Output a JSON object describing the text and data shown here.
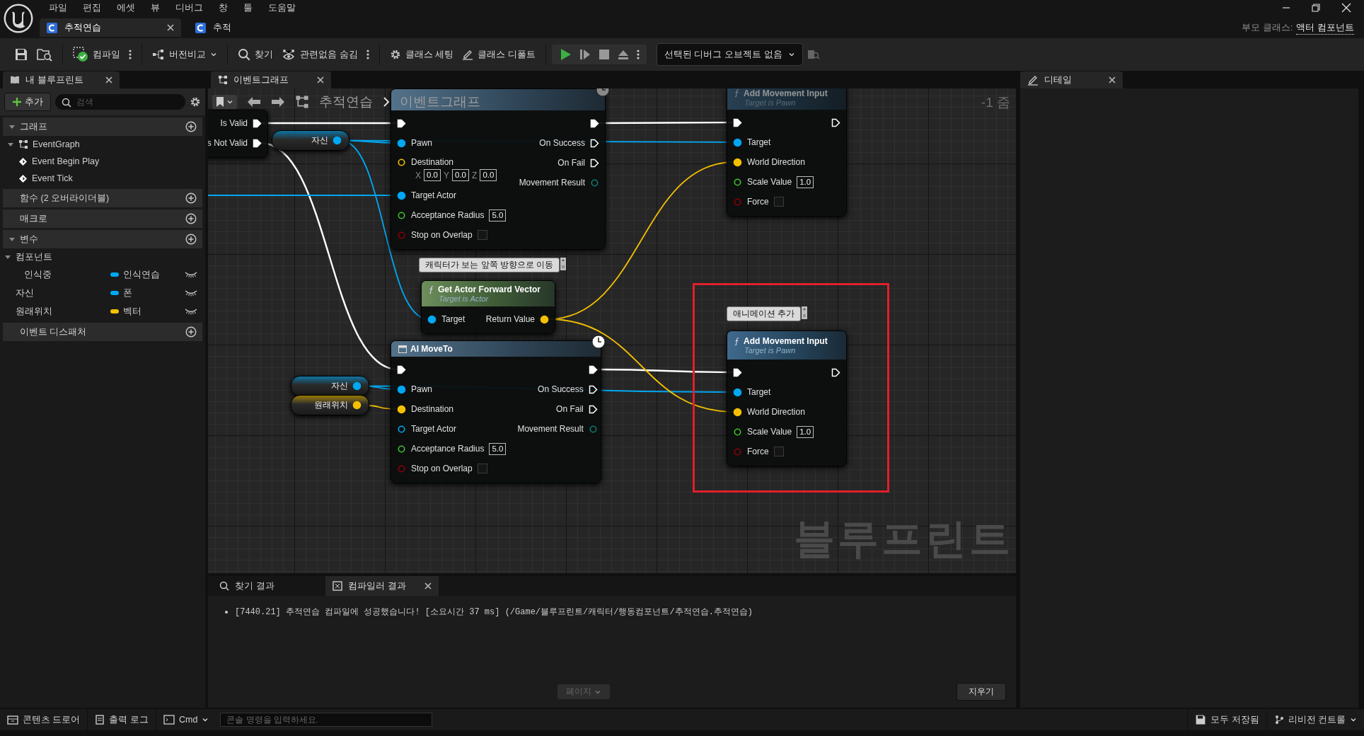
{
  "menu": [
    "파일",
    "편집",
    "에셋",
    "뷰",
    "디버그",
    "창",
    "툴",
    "도움말"
  ],
  "document_tabs": [
    {
      "label": "추적연습",
      "selected": true
    },
    {
      "label": "추적",
      "selected": false
    }
  ],
  "parent_class": {
    "label": "부모 클래스:",
    "value": "액터 컴포넌트"
  },
  "toolbar": {
    "compile": "컴파일",
    "diff": "버전비교",
    "find": "찾기",
    "hide_unrelated": "관련없음 숨김",
    "class_settings": "클래스 세팅",
    "class_defaults": "클래스 디폴트",
    "debug_object": "선택된 디버그 오브젝트 없음"
  },
  "my_blueprint": {
    "tab": "내 블루프린트",
    "add_button": "추가",
    "search_placeholder": "검색",
    "sections": [
      {
        "title": "그래프",
        "expanded": true,
        "items": [
          {
            "label": "EventGraph",
            "kind": "graph",
            "expanded": true,
            "children": [
              {
                "label": "Event Begin Play",
                "kind": "event"
              },
              {
                "label": "Event Tick",
                "kind": "event"
              }
            ]
          }
        ]
      },
      {
        "title": "함수 (2 오버라이더블)",
        "expanded": false
      },
      {
        "title": "매크로",
        "expanded": false
      },
      {
        "title": "변수",
        "expanded": true,
        "items": [
          {
            "label": "컴포넌트",
            "kind": "category",
            "expanded": true,
            "children": [
              {
                "label": "인식중",
                "kind": "variable",
                "type": "인식연습",
                "color": "#00a8f2"
              }
            ]
          },
          {
            "label": "자신",
            "kind": "variable",
            "type": "폰",
            "color": "#00a8f2"
          },
          {
            "label": "원래위치",
            "kind": "variable",
            "type": "벡터",
            "color": "#f5c000"
          }
        ]
      },
      {
        "title": "이벤트 디스패처",
        "expanded": false
      }
    ]
  },
  "graph": {
    "tab": "이벤트그래프",
    "breadcrumb": [
      "추적연습",
      "이벤트그래프"
    ],
    "zoom": "-1 줌",
    "watermark": "블루프린트",
    "nodes": [
      {
        "kind": "fragment",
        "outputs": [
          {
            "label": "Is Valid",
            "kind": "exec",
            "connected": true
          },
          {
            "label": "s Not Valid",
            "kind": "exec",
            "connected": true
          }
        ]
      },
      {
        "kind": "getter",
        "outputs": [
          {
            "label": "자신",
            "kind": "object",
            "connected": true
          }
        ]
      },
      {
        "kind": "latent",
        "inputs": [
          {
            "kind": "exec",
            "connected": true
          },
          {
            "label": "Pawn",
            "kind": "object",
            "connected": true
          },
          {
            "label": "Destination",
            "kind": "vector",
            "connected": false,
            "components": [
              {
                "axis": "X",
                "value": "0.0"
              },
              {
                "axis": "Y",
                "value": "0.0"
              },
              {
                "axis": "Z",
                "value": "0.0"
              }
            ]
          },
          {
            "label": "Target Actor",
            "kind": "object",
            "connected": true
          },
          {
            "label": "Acceptance Radius",
            "kind": "float",
            "connected": false,
            "value": "5.0"
          },
          {
            "label": "Stop on Overlap",
            "kind": "bool",
            "connected": false,
            "checked": false
          }
        ],
        "outputs": [
          {
            "kind": "exec",
            "connected": true
          },
          {
            "label": "On Success",
            "kind": "exec",
            "connected": false
          },
          {
            "label": "On Fail",
            "kind": "exec",
            "connected": false
          },
          {
            "label": "Movement Result",
            "kind": "enum",
            "connected": false
          }
        ]
      },
      {
        "kind": "function",
        "title": "Add Movement Input",
        "subtitle": "Target is Pawn",
        "inputs": [
          {
            "kind": "exec",
            "connected": true
          },
          {
            "label": "Target",
            "kind": "object",
            "connected": true
          },
          {
            "label": "World Direction",
            "kind": "vector",
            "connected": true
          },
          {
            "label": "Scale Value",
            "kind": "float",
            "connected": false,
            "value": "1.0"
          },
          {
            "label": "Force",
            "kind": "bool",
            "connected": false,
            "checked": false
          }
        ],
        "outputs": [
          {
            "kind": "exec",
            "connected": false
          }
        ]
      },
      {
        "kind": "pure",
        "title": "Get Actor Forward Vector",
        "subtitle": "Target is Actor",
        "inputs": [
          {
            "label": "Target",
            "kind": "object",
            "connected": true
          }
        ],
        "outputs": [
          {
            "label": "Return Value",
            "kind": "vector",
            "connected": true
          }
        ]
      },
      {
        "kind": "latent",
        "title": "AI MoveTo",
        "inputs": [
          {
            "kind": "exec",
            "connected": true
          },
          {
            "label": "Pawn",
            "kind": "object",
            "connected": true
          },
          {
            "label": "Destination",
            "kind": "vector",
            "connected": true
          },
          {
            "label": "Target Actor",
            "kind": "object",
            "connected": false
          },
          {
            "label": "Acceptance Radius",
            "kind": "float",
            "connected": false,
            "value": "5.0"
          },
          {
            "label": "Stop on Overlap",
            "kind": "bool",
            "connected": false,
            "checked": false
          }
        ],
        "outputs": [
          {
            "kind": "exec",
            "connected": true
          },
          {
            "label": "On Success",
            "kind": "exec",
            "connected": false
          },
          {
            "label": "On Fail",
            "kind": "exec",
            "connected": false
          },
          {
            "label": "Movement Result",
            "kind": "enum",
            "connected": false
          }
        ]
      },
      {
        "kind": "function",
        "title": "Add Movement Input",
        "subtitle": "Target is Pawn",
        "inputs": [
          {
            "kind": "exec",
            "connected": true
          },
          {
            "label": "Target",
            "kind": "object",
            "connected": true
          },
          {
            "label": "World Direction",
            "kind": "vector",
            "connected": true
          },
          {
            "label": "Scale Value",
            "kind": "float",
            "connected": false,
            "value": "1.0"
          },
          {
            "label": "Force",
            "kind": "bool",
            "connected": false,
            "checked": false
          }
        ],
        "outputs": [
          {
            "kind": "exec",
            "connected": false
          }
        ]
      },
      {
        "kind": "getter",
        "outputs": [
          {
            "label": "자신",
            "kind": "object",
            "connected": true
          }
        ]
      },
      {
        "kind": "getter",
        "outputs": [
          {
            "label": "원래위치",
            "kind": "vector",
            "connected": true
          }
        ]
      }
    ],
    "comments": [
      {
        "text": "캐릭터가 보는 앞쪽 방향으로 이동"
      },
      {
        "text": "애니메이션 추가"
      }
    ]
  },
  "details": {
    "tab": "디테일"
  },
  "output": {
    "tabs": [
      {
        "label": "찾기 결과",
        "selected": false
      },
      {
        "label": "컴파일러 결과",
        "selected": true
      }
    ],
    "messages": [
      "[7440.21] 추적연습 컴파일에 성공했습니다! [소요시간 37 ms] (/Game/블루프린트/캐릭터/행동컴포넌트/추적연습.추적연습)"
    ],
    "page_button": "페이지",
    "clear_button": "지우기"
  },
  "status_bar": {
    "content_drawer": "콘텐츠 드로어",
    "output_log": "출력 로그",
    "cmd": "Cmd",
    "console_placeholder": "콘솔 명령을 입력하세요.",
    "save_state": "모두 저장됨",
    "revision_control": "리비전 컨트롤"
  }
}
